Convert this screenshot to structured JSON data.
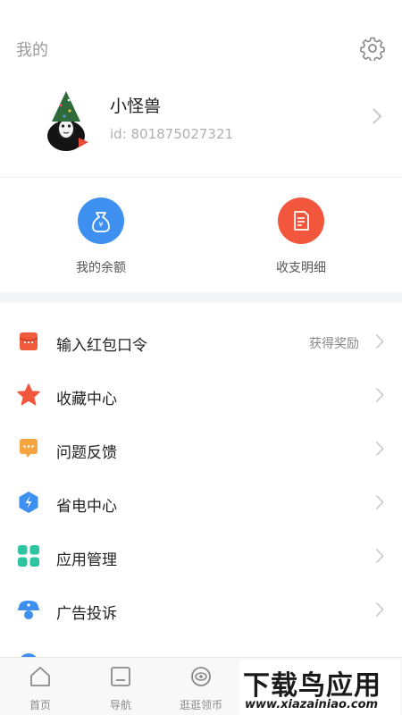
{
  "header": {
    "title": "我的",
    "settings_icon": "gear-icon"
  },
  "profile": {
    "nickname": "小怪兽",
    "id_text": "id: 801875027321"
  },
  "quick_actions": [
    {
      "label": "我的余额",
      "icon": "wallet-icon",
      "color": "#3d8ff0"
    },
    {
      "label": "收支明细",
      "icon": "bill-icon",
      "color": "#f2573d"
    }
  ],
  "menu": [
    {
      "label": "输入红包口令",
      "extra": "获得奖励",
      "icon": "red-envelope-icon"
    },
    {
      "label": "收藏中心",
      "extra": "",
      "icon": "star-icon"
    },
    {
      "label": "问题反馈",
      "extra": "",
      "icon": "feedback-icon"
    },
    {
      "label": "省电中心",
      "extra": "",
      "icon": "power-save-icon"
    },
    {
      "label": "应用管理",
      "extra": "",
      "icon": "app-grid-icon"
    },
    {
      "label": "广告投诉",
      "extra": "",
      "icon": "complaint-icon"
    }
  ],
  "tabs": [
    {
      "label": "首页",
      "icon": "home-icon"
    },
    {
      "label": "导航",
      "icon": "navigation-icon"
    },
    {
      "label": "逛逛领币",
      "icon": "coin-icon"
    }
  ],
  "watermark": {
    "big": "下载鸟应用",
    "small": "www.xiazainiao.com"
  }
}
